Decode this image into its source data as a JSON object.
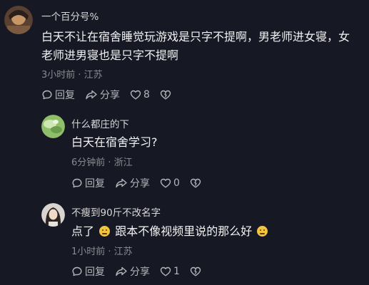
{
  "comments": [
    {
      "username": "一个百分号%",
      "text_line1": "白天不让在宿舍睡觉玩游戏是只字不提啊，男老师进女寝，女",
      "text_line2": "老师进男寝也是只字不提啊",
      "meta": "3小时前 · 江苏",
      "reply_label": "回复",
      "share_label": "分享",
      "like_count": "8"
    },
    {
      "username": "什么都庄的下",
      "text": "白天在宿舍学习?",
      "meta": "6分钟前 · 浙江",
      "reply_label": "回复",
      "share_label": "分享",
      "like_count": "0"
    },
    {
      "username": "不瘦到90斤不改名字",
      "text_part1": "点了",
      "text_part2": "跟本不像视频里说的那么好",
      "meta": "1小时前 · 江苏",
      "reply_label": "回复",
      "share_label": "分享",
      "like_count": "1"
    }
  ],
  "icons": [
    "reply-icon",
    "share-icon",
    "heart-icon",
    "dislike-icon",
    "emoji-icon"
  ],
  "colors": {
    "background": "#161823",
    "meta_text": "#8a8b91",
    "emoji": "#f3c53c"
  }
}
